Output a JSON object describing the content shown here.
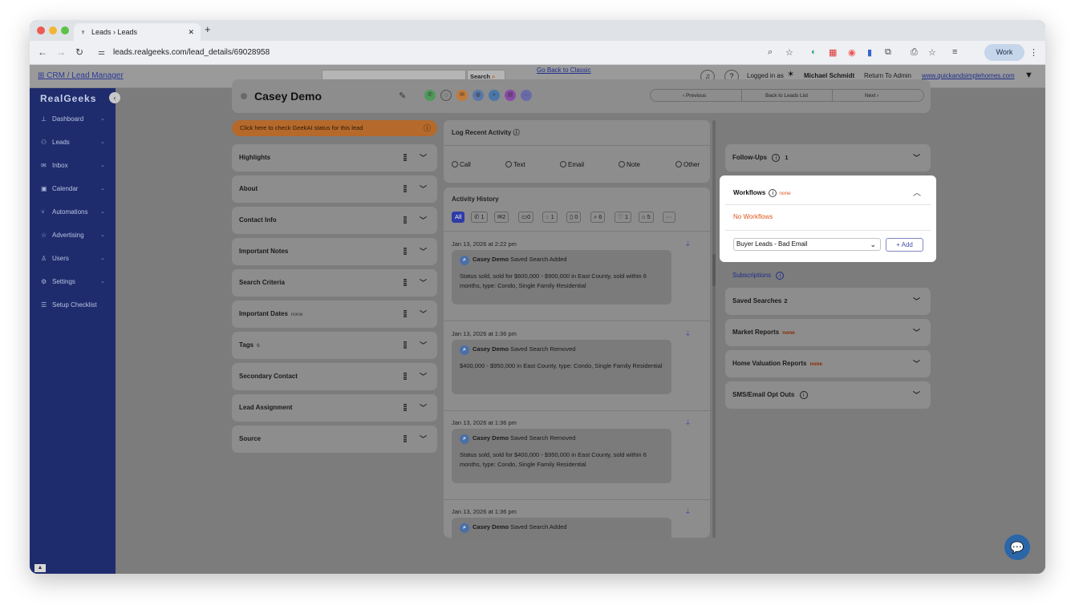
{
  "browser": {
    "tab_title": "Leads › Leads",
    "new_tab": "+",
    "url": "leads.realgeeks.com/lead_details/69028958",
    "profile": "Work"
  },
  "header": {
    "crm_link": "CRM / Lead Manager",
    "search_label": "Search",
    "logged_in_as": "Logged in as",
    "user_name": "Michael Schmidt",
    "return_admin": "Return To Admin",
    "site_link": "www.quickandsimplehomes.com"
  },
  "sidebar": {
    "logo": "RealGeeks",
    "items": [
      {
        "label": "Dashboard",
        "icon": "chart-icon",
        "glyph": "⊥",
        "chevron": true
      },
      {
        "label": "Leads",
        "icon": "users-icon",
        "glyph": "⚇",
        "chevron": true
      },
      {
        "label": "Inbox",
        "icon": "mail-icon",
        "glyph": "✉",
        "chevron": true
      },
      {
        "label": "Calendar",
        "icon": "calendar-icon",
        "glyph": "▣",
        "chevron": true
      },
      {
        "label": "Automations",
        "icon": "automation-icon",
        "glyph": "⑂",
        "chevron": true
      },
      {
        "label": "Advertising",
        "icon": "star-icon",
        "glyph": "☆",
        "chevron": true
      },
      {
        "label": "Users",
        "icon": "user-icon",
        "glyph": "♙",
        "chevron": true
      },
      {
        "label": "Settings",
        "icon": "gear-icon",
        "glyph": "⚙",
        "chevron": true
      },
      {
        "label": "Setup Checklist",
        "icon": "checklist-icon",
        "glyph": "☰",
        "chevron": false
      }
    ]
  },
  "classic_link": "Go Back to Classic",
  "lead": {
    "name": "Casey Demo",
    "nav_previous": "‹  Previous",
    "nav_back": "Back to Leads List",
    "nav_next": "Next  ›",
    "geekai_banner": "Click here to check GeekAI status for this lead"
  },
  "left_sections": [
    {
      "label": "Highlights",
      "sub": ""
    },
    {
      "label": "About",
      "sub": ""
    },
    {
      "label": "Contact Info",
      "sub": ""
    },
    {
      "label": "Important Notes",
      "sub": ""
    },
    {
      "label": "Search Criteria",
      "sub": ""
    },
    {
      "label": "Important Dates",
      "sub": "none"
    },
    {
      "label": "Tags",
      "sub": "6"
    },
    {
      "label": "Secondary Contact",
      "sub": ""
    },
    {
      "label": "Lead Assignment",
      "sub": ""
    },
    {
      "label": "Source",
      "sub": ""
    }
  ],
  "log_activity": {
    "title": "Log Recent Activity",
    "options": [
      "Call",
      "Text",
      "Email",
      "Note",
      "Other"
    ]
  },
  "activity_history": {
    "title": "Activity History",
    "filters": [
      "All",
      "1",
      "2",
      "0",
      "1",
      "0",
      "6",
      "1",
      "5",
      "···"
    ],
    "entries": [
      {
        "date": "Jan 13, 2026 at 2:22 pm",
        "name": "Casey Demo",
        "action": "Saved Search Added",
        "text": "Status sold, sold for $600,000 - $900,000 in East County, sold within 6 months, type: Condo, Single Family Residential"
      },
      {
        "date": "Jan 13, 2026 at 1:36 pm",
        "name": "Casey Demo",
        "action": "Saved Search Removed",
        "text": "$400,000 - $950,000 in East County, type: Condo, Single Family Residential"
      },
      {
        "date": "Jan 13, 2026 at 1:36 pm",
        "name": "Casey Demo",
        "action": "Saved Search Removed",
        "text": "Status sold, sold for $400,000 - $950,000 in East County, sold within 6 months, type: Condo, Single Family Residential"
      },
      {
        "date": "Jan 13, 2026 at 1:36 pm",
        "name": "Casey Demo",
        "action": "Saved Search Added",
        "text": ""
      }
    ]
  },
  "right": {
    "follow_ups": "Follow-Ups",
    "follow_ups_count": "1",
    "workflows_title": "Workflows",
    "workflows_none": "none",
    "no_workflows": "No Workflows",
    "workflow_select": "Buyer Leads - Bad Email",
    "add_label": "+ Add",
    "subscriptions": "Subscriptions",
    "saved_searches": "Saved Searches",
    "saved_searches_count": "2",
    "market_reports": "Market Reports",
    "market_reports_none": "none",
    "home_valuation": "Home Valuation Reports",
    "home_valuation_none": "none",
    "sms_opt_outs": "SMS/Email Opt Outs"
  }
}
